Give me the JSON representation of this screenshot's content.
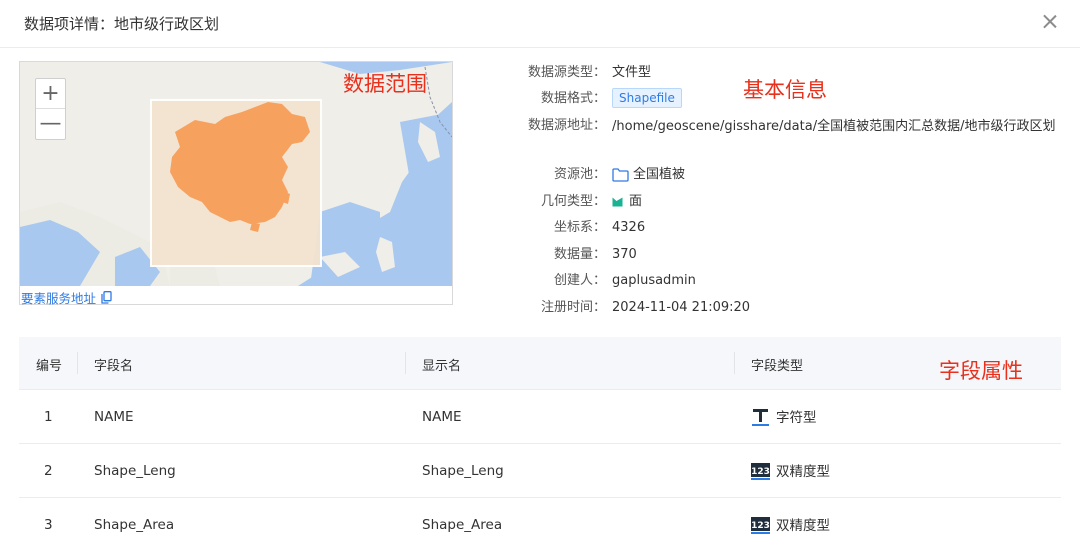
{
  "dialog": {
    "title": "数据项详情：地市级行政区划"
  },
  "map": {
    "zoom_in": "+",
    "zoom_out": "—",
    "annotation": "数据范围",
    "service_link": "要素服务地址"
  },
  "info": {
    "annotation": "基本信息",
    "rows": [
      {
        "label": "数据源类型：",
        "value": "文件型"
      },
      {
        "label": "数据格式：",
        "value": "Shapefile"
      },
      {
        "label": "数据源地址：",
        "value": "/home/geoscene/gisshare/data/全国植被范围内汇总数据/地市级行政区划"
      },
      {
        "label": "资源池：",
        "value": "全国植被"
      },
      {
        "label": "几何类型：",
        "value": "面"
      },
      {
        "label": "坐标系：",
        "value": "4326"
      },
      {
        "label": "数据量：",
        "value": "370"
      },
      {
        "label": "创建人：",
        "value": "gaplusadmin"
      },
      {
        "label": "注册时间：",
        "value": "2024-11-04 21:09:20"
      }
    ]
  },
  "table": {
    "annotation": "字段属性",
    "headers": [
      "编号",
      "字段名",
      "显示名",
      "字段类型"
    ],
    "rows": [
      {
        "index": "1",
        "field": "NAME",
        "display": "NAME",
        "type": "字符型",
        "icon": "text-type-icon"
      },
      {
        "index": "2",
        "field": "Shape_Leng",
        "display": "Shape_Leng",
        "type": "双精度型",
        "icon": "number-type-icon"
      },
      {
        "index": "3",
        "field": "Shape_Area",
        "display": "Shape_Area",
        "type": "双精度型",
        "icon": "number-type-icon"
      }
    ]
  },
  "colors": {
    "accent": "#2f7be5",
    "annotation": "#e8301c",
    "extent_fill": "#f7a15e",
    "water": "#a8c8ef",
    "geometry_icon": "#19b394"
  }
}
